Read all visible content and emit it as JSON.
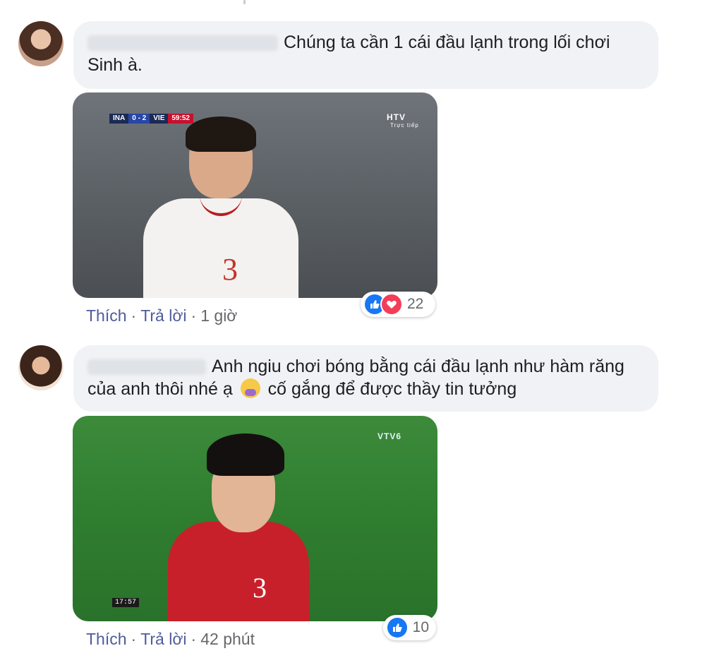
{
  "comments": [
    {
      "text": "Chúng ta cần 1 cái đầu lạnh trong lối chơi Sinh à.",
      "media": {
        "scoreboard": {
          "home": "INA",
          "score": "0 - 2",
          "away": "VIE",
          "time": "59:52"
        },
        "channel": "HTV",
        "channel_sub": "Trực tiếp",
        "jersey_number": "3"
      },
      "actions": {
        "like": "Thích",
        "reply": "Trả lời",
        "time": "1 giờ"
      },
      "reactions": {
        "types": [
          "like-icon",
          "love-icon"
        ],
        "count": "22"
      }
    },
    {
      "text_part1": "Anh ngiu chơi bóng bằng cái đầu lạnh như hàm răng của anh thôi nhé ạ",
      "text_part2": "cố gắng để được thầy tin tưởng",
      "media": {
        "channel": "VTV6",
        "clock": "17:57",
        "jersey_number": "3"
      },
      "actions": {
        "like": "Thích",
        "reply": "Trả lời",
        "time": "42 phút"
      },
      "reactions": {
        "types": [
          "like-icon"
        ],
        "count": "10"
      }
    }
  ],
  "colors": {
    "bubble": "#f0f2f5",
    "link": "#4f5b9c",
    "like": "#1877f2",
    "love": "#f33e58"
  }
}
